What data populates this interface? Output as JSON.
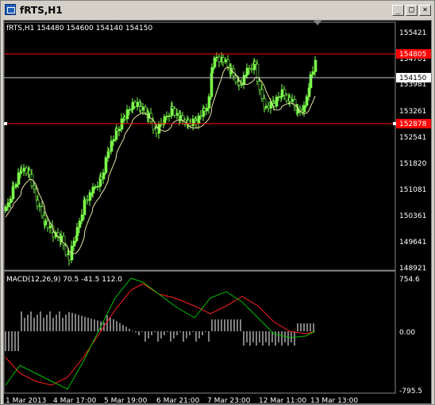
{
  "window": {
    "title": "fRTS,H1",
    "minimize_symbol": "_",
    "maximize_symbol": "□",
    "close_symbol": "×"
  },
  "main_chart": {
    "header": "fRTS,H1  154480 154600 154140 154150",
    "price_ticks": [
      "155421",
      "154701",
      "153981",
      "153261",
      "152541",
      "151820",
      "151081",
      "150361",
      "149641",
      "148921"
    ],
    "resistance_label": "154805",
    "support_label": "152878",
    "current_label": "154150"
  },
  "macd": {
    "header": "MACD(12,26,9) 70.5 -41.5 112.0",
    "ticks": [
      "754.6",
      "0.00",
      "-795.5"
    ]
  },
  "x_axis": {
    "labels": [
      "1 Mar 2013",
      "4 Mar 17:00",
      "5 Mar 19:00",
      "6 Mar 21:00",
      "7 Mar 23:00",
      "12 Mar 11:00",
      "13 Mar 13:00"
    ]
  },
  "colors": {
    "bull": "#7cff4a",
    "ma": "#e8e6a0",
    "level": "#ff0000",
    "current": "#c8c8c8",
    "macd_main": "#ff2020",
    "macd_signal": "#00c000",
    "macd_hist": "#ffffff"
  }
}
